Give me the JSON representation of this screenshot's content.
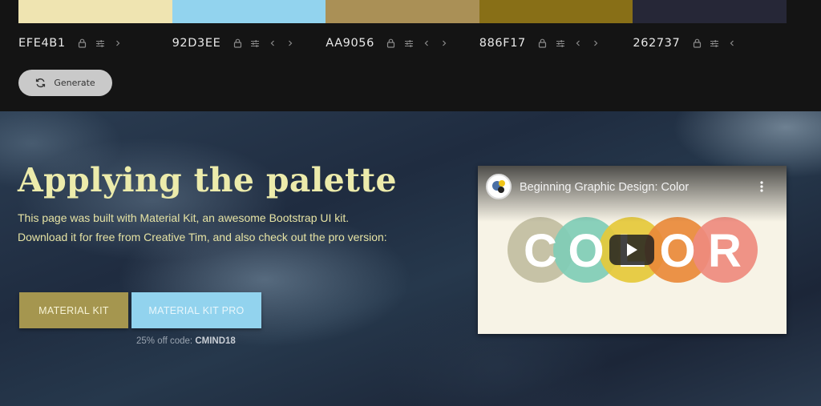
{
  "palette": {
    "swatches": [
      {
        "hex": "EFE4B1",
        "color": "#EFE4B1",
        "controls": [
          "lock-icon",
          "sliders-icon",
          "chevron-right-icon"
        ]
      },
      {
        "hex": "92D3EE",
        "color": "#92D3EE",
        "controls": [
          "lock-icon",
          "sliders-icon",
          "chevron-left-icon",
          "chevron-right-icon"
        ]
      },
      {
        "hex": "AA9056",
        "color": "#AA9056",
        "controls": [
          "lock-icon",
          "sliders-icon",
          "chevron-left-icon",
          "chevron-right-icon"
        ]
      },
      {
        "hex": "886F17",
        "color": "#886F17",
        "controls": [
          "lock-icon",
          "sliders-icon",
          "chevron-left-icon",
          "chevron-right-icon"
        ]
      },
      {
        "hex": "262737",
        "color": "#262737",
        "controls": [
          "lock-icon",
          "sliders-icon",
          "chevron-left-icon"
        ]
      }
    ],
    "generate_label": "Generate",
    "generate_icon": "refresh-icon"
  },
  "hero": {
    "title": "Applying the palette",
    "description": "This page was built with Material Kit, an awesome Bootstrap UI kit. Download it for free from Creative Tim, and also check out the pro version:",
    "buttons": {
      "kit_label": "MATERIAL KIT",
      "pro_label": "MATERIAL KIT PRO"
    },
    "discount_prefix": "25% off code: ",
    "discount_code": "CMIND18"
  },
  "video": {
    "title": "Beginning Graphic Design: Color",
    "thumbnail_text": "COLOR",
    "thumbnail_letters": [
      "C",
      "O",
      "L",
      "O",
      "R"
    ],
    "circle_colors": [
      "#c6c2a6",
      "#7fcdb6",
      "#e5c93a",
      "#e98a39",
      "#ee8b7e"
    ],
    "avatar_icon": "channel-avatar-icon",
    "menu_icon": "more-vert-icon",
    "play_icon": "play-icon"
  },
  "colors": {
    "title": "#ECEBAB",
    "button_kit": "#A5964F",
    "button_pro": "#92D3EE",
    "generate_button": "#C9C9C9"
  }
}
